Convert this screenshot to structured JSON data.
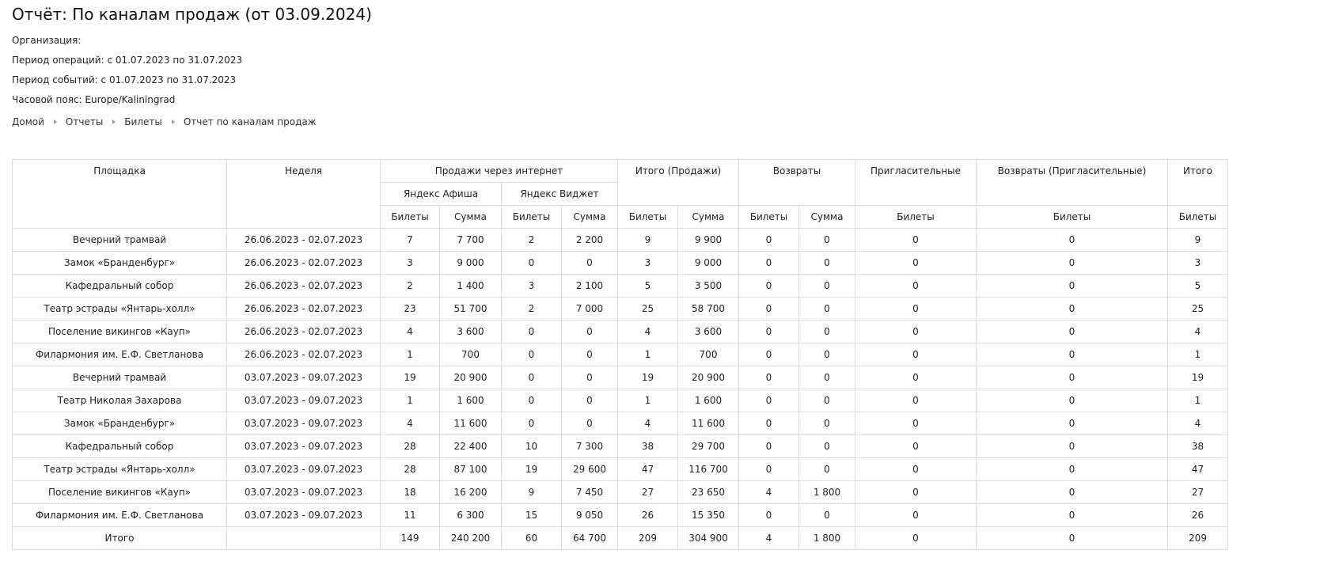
{
  "title": "Отчёт: По каналам продаж (от 03.09.2024)",
  "meta": {
    "organization": "Организация:",
    "operations_period": "Период операций: с 01.07.2023 по 31.07.2023",
    "events_period": "Период событий: с 01.07.2023 по 31.07.2023",
    "timezone": "Часовой пояс: Europe/Kaliningrad"
  },
  "breadcrumb": [
    "Домой",
    "Отчеты",
    "Билеты",
    "Отчет по каналам продаж"
  ],
  "table": {
    "headers": {
      "venue": "Площадка",
      "week": "Неделя",
      "internet_sales": "Продажи через интернет",
      "yandex_afisha": "Яндекс Афиша",
      "yandex_widget": "Яндекс Виджет",
      "total_sales": "Итого (Продажи)",
      "returns": "Возвраты",
      "invitations": "Пригласительные",
      "invitation_returns": "Возвраты (Пригласительные)",
      "total": "Итого",
      "tickets": "Билеты",
      "sum": "Сумма"
    },
    "rows": [
      [
        "Вечерний трамвай",
        "26.06.2023 - 02.07.2023",
        "7",
        "7 700",
        "2",
        "2 200",
        "9",
        "9 900",
        "0",
        "0",
        "0",
        "0",
        "9"
      ],
      [
        "Замок «Бранденбург»",
        "26.06.2023 - 02.07.2023",
        "3",
        "9 000",
        "0",
        "0",
        "3",
        "9 000",
        "0",
        "0",
        "0",
        "0",
        "3"
      ],
      [
        "Кафедральный собор",
        "26.06.2023 - 02.07.2023",
        "2",
        "1 400",
        "3",
        "2 100",
        "5",
        "3 500",
        "0",
        "0",
        "0",
        "0",
        "5"
      ],
      [
        "Театр эстрады «Янтарь-холл»",
        "26.06.2023 - 02.07.2023",
        "23",
        "51 700",
        "2",
        "7 000",
        "25",
        "58 700",
        "0",
        "0",
        "0",
        "0",
        "25"
      ],
      [
        "Поселение викингов «Кауп»",
        "26.06.2023 - 02.07.2023",
        "4",
        "3 600",
        "0",
        "0",
        "4",
        "3 600",
        "0",
        "0",
        "0",
        "0",
        "4"
      ],
      [
        "Филармония им. Е.Ф. Светланова",
        "26.06.2023 - 02.07.2023",
        "1",
        "700",
        "0",
        "0",
        "1",
        "700",
        "0",
        "0",
        "0",
        "0",
        "1"
      ],
      [
        "Вечерний трамвай",
        "03.07.2023 - 09.07.2023",
        "19",
        "20 900",
        "0",
        "0",
        "19",
        "20 900",
        "0",
        "0",
        "0",
        "0",
        "19"
      ],
      [
        "Театр Николая Захарова",
        "03.07.2023 - 09.07.2023",
        "1",
        "1 600",
        "0",
        "0",
        "1",
        "1 600",
        "0",
        "0",
        "0",
        "0",
        "1"
      ],
      [
        "Замок «Бранденбург»",
        "03.07.2023 - 09.07.2023",
        "4",
        "11 600",
        "0",
        "0",
        "4",
        "11 600",
        "0",
        "0",
        "0",
        "0",
        "4"
      ],
      [
        "Кафедральный собор",
        "03.07.2023 - 09.07.2023",
        "28",
        "22 400",
        "10",
        "7 300",
        "38",
        "29 700",
        "0",
        "0",
        "0",
        "0",
        "38"
      ],
      [
        "Театр эстрады «Янтарь-холл»",
        "03.07.2023 - 09.07.2023",
        "28",
        "87 100",
        "19",
        "29 600",
        "47",
        "116 700",
        "0",
        "0",
        "0",
        "0",
        "47"
      ],
      [
        "Поселение викингов «Кауп»",
        "03.07.2023 - 09.07.2023",
        "18",
        "16 200",
        "9",
        "7 450",
        "27",
        "23 650",
        "4",
        "1 800",
        "0",
        "0",
        "27"
      ],
      [
        "Филармония им. Е.Ф. Светланова",
        "03.07.2023 - 09.07.2023",
        "11",
        "6 300",
        "15",
        "9 050",
        "26",
        "15 350",
        "0",
        "0",
        "0",
        "0",
        "26"
      ],
      [
        "Итого",
        "",
        "149",
        "240 200",
        "60",
        "64 700",
        "209",
        "304 900",
        "4",
        "1 800",
        "0",
        "0",
        "209"
      ]
    ]
  },
  "colors": {
    "border": "#dcdcdc",
    "text": "#222222",
    "breadcrumb_separator": "#9a9a9a"
  },
  "icons": {
    "breadcrumb_separator": "triangle-right-icon"
  }
}
